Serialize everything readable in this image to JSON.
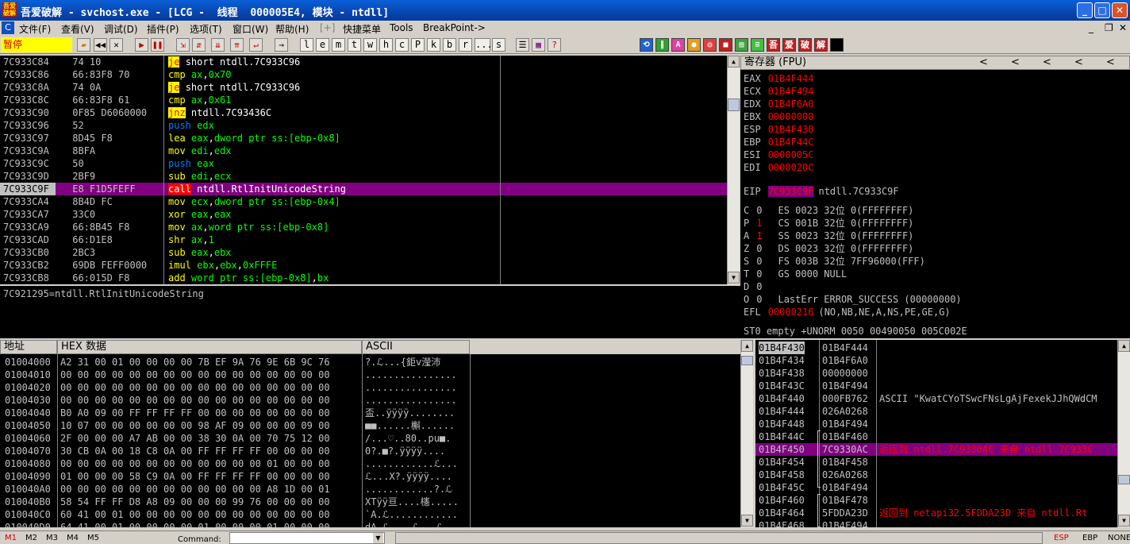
{
  "titlebar": {
    "icon_text": "吾爱破解",
    "title": "吾爱破解 - svchost.exe - [LCG -  线程  000005E4, 模块 - ntdll]",
    "minimize": "_",
    "maximize": "□",
    "close": "✕"
  },
  "menu": {
    "items": [
      "文件(F)",
      "查看(V)",
      "调试(D)",
      "插件(P)",
      "选项(T)",
      "窗口(W)",
      "帮助(H)",
      "[+]",
      "快捷菜单",
      "Tools",
      "BreakPoint->"
    ]
  },
  "toolbar": {
    "state": "暂停",
    "letters": [
      "l",
      "e",
      "m",
      "t",
      "w",
      "h",
      "c",
      "P",
      "k",
      "b",
      "r",
      "...",
      "s"
    ]
  },
  "disasm": {
    "rows": [
      {
        "addr": "7C933C84",
        "hex": " 74 10",
        "mn": "je",
        "op": [
          [
            "t",
            "short ntdll.7C933C96"
          ]
        ]
      },
      {
        "addr": "7C933C86",
        "hex": " 66:83F8 70",
        "mn": "cmp",
        "op": [
          [
            "r",
            "ax"
          ],
          [
            "t",
            ","
          ],
          [
            "n",
            "0x70"
          ]
        ]
      },
      {
        "addr": "7C933C8A",
        "hex": " 74 0A",
        "mn": "je",
        "op": [
          [
            "t",
            "short ntdll.7C933C96"
          ]
        ]
      },
      {
        "addr": "7C933C8C",
        "hex": " 66:83F8 61",
        "mn": "cmp",
        "op": [
          [
            "r",
            "ax"
          ],
          [
            "t",
            ","
          ],
          [
            "n",
            "0x61"
          ]
        ]
      },
      {
        "addr": "7C933C90",
        "hex": " 0F85 D6060000",
        "mn": "jnz",
        "op": [
          [
            "t",
            "ntdll.7C93436C"
          ]
        ]
      },
      {
        "addr": "7C933C96",
        "hex": " 52",
        "mn": "push",
        "op": [
          [
            "r",
            "edx"
          ]
        ]
      },
      {
        "addr": "7C933C97",
        "hex": " 8D45 F8",
        "mn": "lea",
        "op": [
          [
            "r",
            "eax"
          ],
          [
            "t",
            ","
          ],
          [
            "r",
            "dword ptr ss:[ebp-0x8]"
          ]
        ]
      },
      {
        "addr": "7C933C9A",
        "hex": " 8BFA",
        "mn": "mov",
        "op": [
          [
            "r",
            "edi"
          ],
          [
            "t",
            ","
          ],
          [
            "r",
            "edx"
          ]
        ]
      },
      {
        "addr": "7C933C9C",
        "hex": " 50",
        "mn": "push",
        "op": [
          [
            "r",
            "eax"
          ]
        ]
      },
      {
        "addr": "7C933C9D",
        "hex": " 2BF9",
        "mn": "sub",
        "op": [
          [
            "r",
            "edi"
          ],
          [
            "t",
            ","
          ],
          [
            "r",
            "ecx"
          ]
        ]
      },
      {
        "addr": "7C933C9F",
        "hex": " E8 F1D5FEFF",
        "mn": "call",
        "op": [
          [
            "t",
            "ntdll.RtlInitUnicodeString"
          ]
        ],
        "sel": true
      },
      {
        "addr": "7C933CA4",
        "hex": " 8B4D FC",
        "mn": "mov",
        "op": [
          [
            "r",
            "ecx"
          ],
          [
            "t",
            ","
          ],
          [
            "r",
            "dword ptr ss:[ebp-0x4]"
          ]
        ]
      },
      {
        "addr": "7C933CA7",
        "hex": " 33C0",
        "mn": "xor",
        "op": [
          [
            "r",
            "eax"
          ],
          [
            "t",
            ","
          ],
          [
            "r",
            "eax"
          ]
        ]
      },
      {
        "addr": "7C933CA9",
        "hex": " 66:8B45 F8",
        "mn": "mov",
        "op": [
          [
            "r",
            "ax"
          ],
          [
            "t",
            ","
          ],
          [
            "r",
            "word ptr ss:[ebp-0x8]"
          ]
        ]
      },
      {
        "addr": "7C933CAD",
        "hex": " 66:D1E8",
        "mn": "shr",
        "op": [
          [
            "r",
            "ax"
          ],
          [
            "t",
            ","
          ],
          [
            "n",
            "1"
          ]
        ]
      },
      {
        "addr": "7C933CB0",
        "hex": " 2BC3",
        "mn": "sub",
        "op": [
          [
            "r",
            "eax"
          ],
          [
            "t",
            ","
          ],
          [
            "r",
            "ebx"
          ]
        ]
      },
      {
        "addr": "7C933CB2",
        "hex": " 69DB FEFF0000",
        "mn": "imul",
        "op": [
          [
            "r",
            "ebx"
          ],
          [
            "t",
            ","
          ],
          [
            "r",
            "ebx"
          ],
          [
            "t",
            ","
          ],
          [
            "n",
            "0xFFFE"
          ]
        ]
      },
      {
        "addr": "7C933CB8",
        "hex": " 66:015D F8",
        "mn": "add",
        "op": [
          [
            "r",
            "word ptr ss:[ebp-0x8]"
          ],
          [
            "t",
            ","
          ],
          [
            "r",
            "bx"
          ]
        ]
      }
    ],
    "info": "7C921295=ntdll.RtlInitUnicodeString"
  },
  "registers": {
    "header": "寄存器 (FPU)",
    "arrows": [
      "<",
      "<",
      "<",
      "<",
      "<"
    ],
    "gp": [
      {
        "name": "EAX",
        "value": "01B4F444"
      },
      {
        "name": "ECX",
        "value": "01B4F494"
      },
      {
        "name": "EDX",
        "value": "01B4F6A0"
      },
      {
        "name": "EBX",
        "value": "00000000"
      },
      {
        "name": "ESP",
        "value": "01B4F430"
      },
      {
        "name": "EBP",
        "value": "01B4F44C"
      },
      {
        "name": "ESI",
        "value": "0000005C"
      },
      {
        "name": "EDI",
        "value": "0000020C"
      }
    ],
    "eip": {
      "name": "EIP",
      "value": "7C933C9F",
      "comment": "ntdll.7C933C9F"
    },
    "flags": [
      {
        "f": "C",
        "v": "0",
        "red": false,
        "rest": "ES 0023 32位 0(FFFFFFFF)"
      },
      {
        "f": "P",
        "v": "1",
        "red": true,
        "rest": "CS 001B 32位 0(FFFFFFFF)"
      },
      {
        "f": "A",
        "v": "1",
        "red": true,
        "rest": "SS 0023 32位 0(FFFFFFFF)"
      },
      {
        "f": "Z",
        "v": "0",
        "red": false,
        "rest": "DS 0023 32位 0(FFFFFFFF)"
      },
      {
        "f": "S",
        "v": "0",
        "red": false,
        "rest": "FS 003B 32位 7FF96000(FFF)"
      },
      {
        "f": "T",
        "v": "0",
        "red": false,
        "rest": "GS 0000 NULL"
      },
      {
        "f": "D",
        "v": "0",
        "red": false,
        "rest": ""
      },
      {
        "f": "O",
        "v": "0",
        "red": false,
        "rest": "LastErr ERROR_SUCCESS (00000000)"
      }
    ],
    "efl": {
      "name": "EFL",
      "value": "00000216",
      "comment": "(NO,NB,NE,A,NS,PE,GE,G)"
    },
    "st0": "ST0 empty +UNORM 0050 00490050 005C002E"
  },
  "dump": {
    "header_addr": "地址",
    "header_hex": "HEX 数据",
    "header_ascii": "ASCII",
    "rows": [
      {
        "addr": "01004000",
        "hex": "A2 31 00 01 00 00 00 00 7B EF 9A 76 9E 6B 9C 76",
        "ascii": "?.ℒ...{鉅v瀅沛"
      },
      {
        "addr": "01004010",
        "hex": "00 00 00 00 00 00 00 00 00 00 00 00 00 00 00 00",
        "ascii": "................"
      },
      {
        "addr": "01004020",
        "hex": "00 00 00 00 00 00 00 00 00 00 00 00 00 00 00 00",
        "ascii": "................"
      },
      {
        "addr": "01004030",
        "hex": "00 00 00 00 00 00 00 00 00 00 00 00 00 00 00 00",
        "ascii": "................"
      },
      {
        "addr": "01004040",
        "hex": "B0 A0 09 00 FF FF FF FF 00 00 00 00 00 00 00 00",
        "ascii": "盃..ÿÿÿÿ........"
      },
      {
        "addr": "01004050",
        "hex": "10 07 00 00 00 00 00 00 98 AF 09 00 00 00 09 00",
        "ascii": "■■......槲......"
      },
      {
        "addr": "01004060",
        "hex": "2F 00 00 00 A7 AB 00 00 38 30 0A 00 70 75 12 00",
        "ascii": "/...♡..80..pu■."
      },
      {
        "addr": "01004070",
        "hex": "30 CB 0A 00 18 C8 0A 00 FF FF FF FF 00 00 00 00",
        "ascii": "0?.■?.ÿÿÿÿ...."
      },
      {
        "addr": "01004080",
        "hex": "00 00 00 00 00 00 00 00 00 00 00 00 01 00 00 00",
        "ascii": "............ℒ..."
      },
      {
        "addr": "01004090",
        "hex": "01 00 00 00 58 C9 0A 00 FF FF FF FF 00 00 00 00",
        "ascii": "ℒ...X?.ÿÿÿÿ...."
      },
      {
        "addr": "010040A0",
        "hex": "00 00 00 00 00 00 00 00 00 00 00 00 A8 1D 00 01",
        "ascii": "............?.ℒ"
      },
      {
        "addr": "010040B0",
        "hex": "58 54 FF FF D8 A8 09 00 00 00 99 76 00 00 00 00",
        "ascii": "XTÿÿ亘....櫶....."
      },
      {
        "addr": "010040C0",
        "hex": "60 41 00 01 00 00 00 00 00 00 00 00 00 00 00 00",
        "ascii": "`A.ℒ............"
      },
      {
        "addr": "010040D0",
        "hex": "64 41 00 01 00 00 00 00 01 00 00 00 01 00 00 00",
        "ascii": "dA.ℒ....ℒ...ℒ..."
      }
    ]
  },
  "stack": {
    "rows": [
      {
        "addr": "01B4F430",
        "val": "01B4F444",
        "comment": "",
        "sel": false,
        "hl": true
      },
      {
        "addr": "01B4F434",
        "val": "01B4F6A0",
        "comment": "",
        "sel": false
      },
      {
        "addr": "01B4F438",
        "val": "00000000",
        "comment": "",
        "sel": false
      },
      {
        "addr": "01B4F43C",
        "val": "01B4F494",
        "comment": "",
        "sel": false
      },
      {
        "addr": "01B4F440",
        "val": "000FB762",
        "comment": "ASCII \"KwatCYoTSwcFNsLgAjFexekJJhQWdCM",
        "sel": false
      },
      {
        "addr": "01B4F444",
        "val": "026A0268",
        "comment": "",
        "sel": false
      },
      {
        "addr": "01B4F448",
        "val": "01B4F494",
        "comment": "",
        "sel": false
      },
      {
        "addr": "01B4F44C",
        "val": "01B4F460",
        "comment": "",
        "sel": false
      },
      {
        "addr": "01B4F450",
        "val": "7C9330AC",
        "comment": "返回到 ntdll.7C9330AC 来自 ntdll.7C933C",
        "sel": true
      },
      {
        "addr": "01B4F454",
        "val": "01B4F458",
        "comment": "",
        "sel": false
      },
      {
        "addr": "01B4F458",
        "val": "026A0268",
        "comment": "",
        "sel": false
      },
      {
        "addr": "01B4F45C",
        "val": "01B4F494",
        "comment": "",
        "sel": false
      },
      {
        "addr": "01B4F460",
        "val": "01B4F478",
        "comment": "",
        "sel": false
      },
      {
        "addr": "01B4F464",
        "val": "5FDDA23D",
        "comment": "返回到 netapi32.5FDDA23D 来自 ntdll.Rt",
        "sel": false,
        "redc": true
      },
      {
        "addr": "01B4F468",
        "val": "01B4F494",
        "comment": "",
        "sel": false
      }
    ]
  },
  "status": {
    "marks": [
      "M1",
      "M2",
      "M3",
      "M4",
      "M5"
    ],
    "command_label": "Command:",
    "right": [
      "ESP",
      "EBP",
      "NONE"
    ]
  }
}
